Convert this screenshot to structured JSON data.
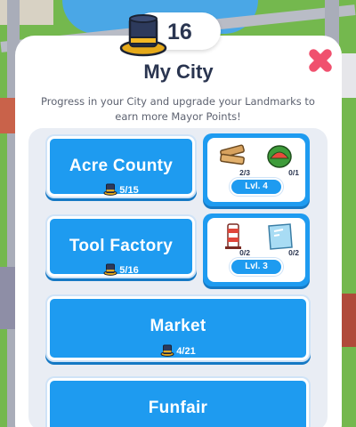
{
  "header": {
    "mayor_points": "16",
    "title": "My City",
    "subtitle": "Progress in your City and upgrade your Landmarks to earn more Mayor Points!"
  },
  "icons": {
    "currency": "top-hat-icon",
    "close": "close-x-icon"
  },
  "colors": {
    "accent_blue": "#1e9bf0",
    "panel": "#ffffff",
    "close_pink": "#f0506e",
    "text_dark": "#2a3550"
  },
  "landmarks": [
    {
      "name": "Acre County",
      "progress": "5/15",
      "level": "Lvl. 4",
      "items": [
        {
          "icon": "wood-planks-icon",
          "count": "2/3"
        },
        {
          "icon": "watermelon-icon",
          "count": "0/1"
        }
      ]
    },
    {
      "name": "Tool Factory",
      "progress": "5/16",
      "level": "Lvl. 3",
      "items": [
        {
          "icon": "traffic-barrier-icon",
          "count": "0/2"
        },
        {
          "icon": "glass-pane-icon",
          "count": "0/2"
        }
      ]
    },
    {
      "name": "Market",
      "progress": "4/21"
    },
    {
      "name": "Funfair"
    }
  ]
}
